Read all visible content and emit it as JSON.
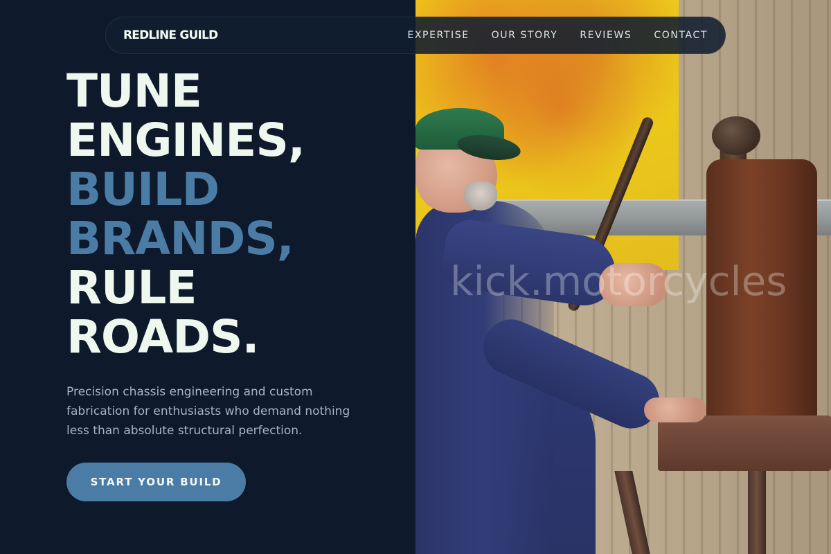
{
  "nav": {
    "brand": "REDLINE GUILD",
    "links": [
      {
        "label": "EXPERTISE"
      },
      {
        "label": "OUR STORY"
      },
      {
        "label": "REVIEWS"
      },
      {
        "label": "CONTACT"
      }
    ]
  },
  "hero": {
    "lines": [
      {
        "text": "TUNE",
        "style": "light"
      },
      {
        "text": "ENGINES,",
        "style": "light"
      },
      {
        "text": "BUILD",
        "style": "accent"
      },
      {
        "text": "BRANDS,",
        "style": "accent"
      },
      {
        "text": "RULE",
        "style": "light"
      },
      {
        "text": "ROADS.",
        "style": "light"
      }
    ],
    "subtitle": "Precision chassis engineering and custom fabrication for enthusiasts who demand nothing less than absolute structural perfection.",
    "cta_label": "START YOUR BUILD"
  },
  "photo": {
    "watermark": "kick.motorcycles"
  },
  "colors": {
    "background": "#0e1a2b",
    "accent": "#4a7ca6",
    "heading": "#eef8ee",
    "body_text": "#a8b4c2"
  }
}
